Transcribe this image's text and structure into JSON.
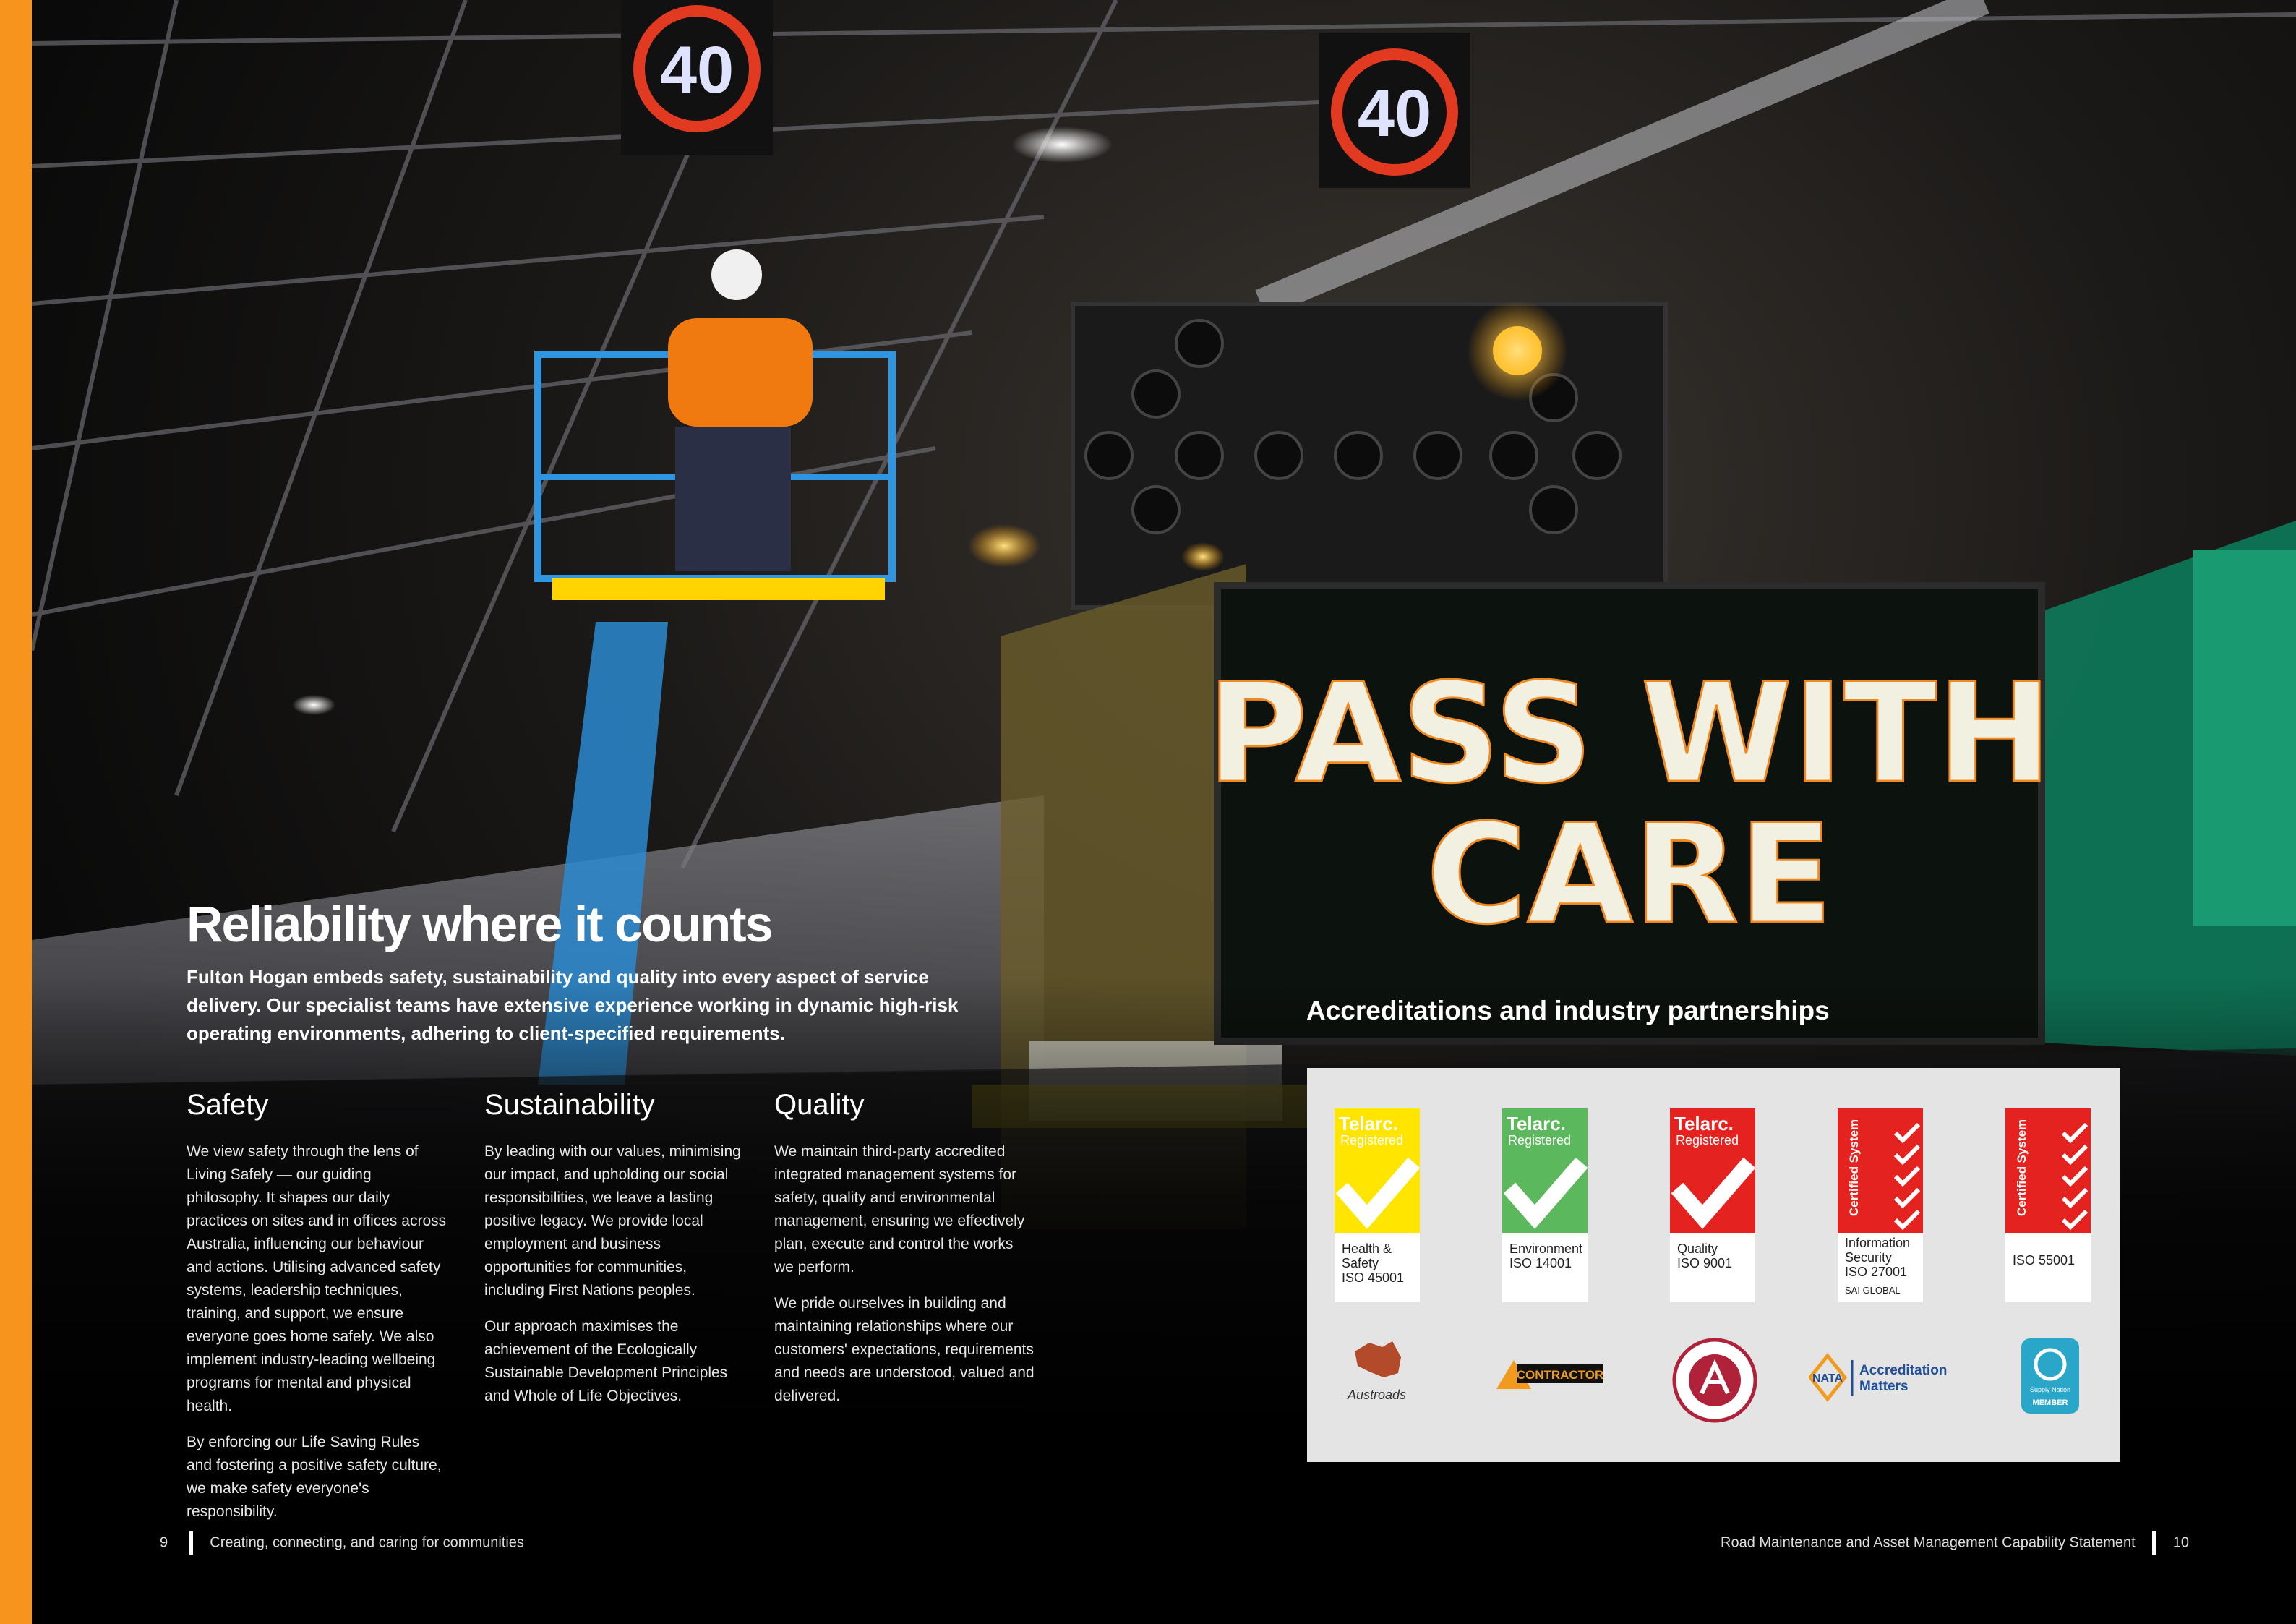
{
  "photo_sign": {
    "speed_1": "40",
    "speed_2": "40",
    "vms_line1": "PASS WITH",
    "vms_line2": "CARE"
  },
  "heading": {
    "title": "Reliability where it counts",
    "intro": "Fulton Hogan embeds safety, sustainability and quality into every aspect of service delivery. Our specialist teams have extensive experience working in dynamic high-risk operating environments, adhering to client-specified requirements."
  },
  "columns": [
    {
      "title": "Safety",
      "paragraphs": [
        "We view safety through the lens of Living Safely — our guiding philosophy. It shapes our daily practices on sites and in offices across Australia, influencing our behaviour and actions. Utilising advanced safety systems, leadership techniques, training, and support, we ensure everyone goes home safely. We also implement industry-leading wellbeing programs for mental and physical health.",
        "By enforcing our Life Saving Rules and fostering a positive safety culture, we make safety everyone's responsibility."
      ]
    },
    {
      "title": "Sustainability",
      "paragraphs": [
        "By leading with our values, minimising our impact, and upholding our social responsibilities, we leave a lasting positive legacy. We provide local employment and business opportunities for communities, including First Nations peoples.",
        "Our approach maximises the achievement of the Ecologically Sustainable Development Principles and Whole of Life Objectives."
      ]
    },
    {
      "title": "Quality",
      "paragraphs": [
        "We maintain third-party accredited integrated management systems for safety, quality and environmental management, ensuring we effectively plan, execute and control the works we perform.",
        "We pride ourselves in building and maintaining relationships where our customers' expectations, requirements and needs are understood, valued and delivered."
      ]
    }
  ],
  "accreditations": {
    "title": "Accreditations and industry partnerships",
    "badges": [
      {
        "brand": "Telarc.",
        "sub": "Registered",
        "caption": "Health &\nSafety\nISO 45001",
        "color": "#ffe500"
      },
      {
        "brand": "Telarc.",
        "sub": "Registered",
        "caption": "Environment\nISO 14001",
        "color": "#5cb85c"
      },
      {
        "brand": "Telarc.",
        "sub": "Registered",
        "caption": "Quality\nISO 9001",
        "color": "#e42320"
      }
    ],
    "certs": [
      {
        "band": "Certified System",
        "caption": "Information\nSecurity\nISO 27001",
        "sai": "SAI GLOBAL"
      },
      {
        "band": "Certified System",
        "caption": "ISO 55001"
      }
    ],
    "logos": {
      "austroads": "Austroads",
      "contractor": "CONTRACTOR",
      "nata_left": "NATA",
      "nata_right_1": "Accreditation",
      "nata_right_2": "Matters",
      "supply_1": "Supply Nation",
      "supply_2": "MEMBER"
    }
  },
  "footer": {
    "left_page": "9",
    "left_text": "Creating, connecting, and caring for communities",
    "right_text": "Road Maintenance and Asset Management Capability Statement",
    "right_page": "10"
  },
  "colors": {
    "accent": "#f7941d"
  }
}
